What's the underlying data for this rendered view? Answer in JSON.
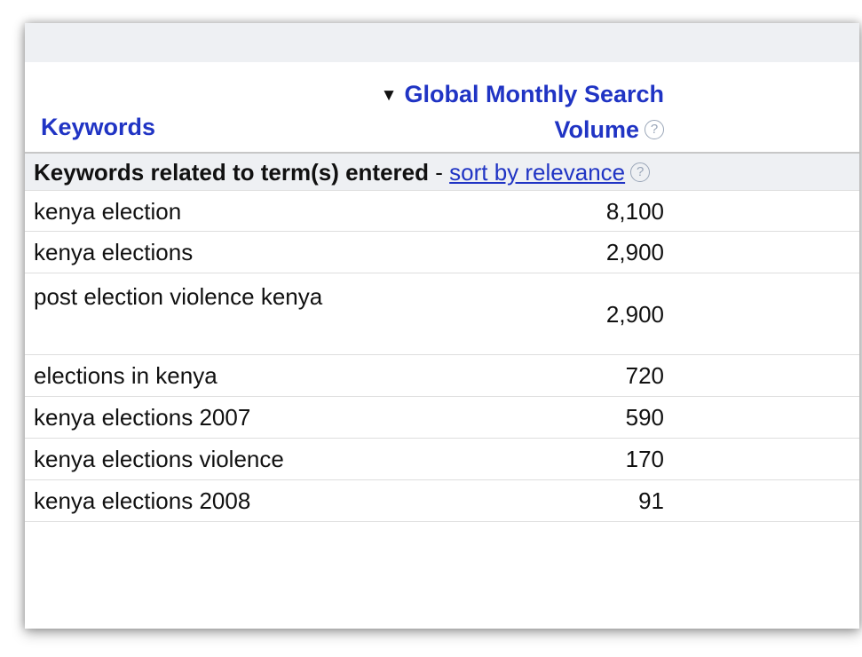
{
  "header": {
    "keywords_label": "Keywords",
    "volume_label_line1": "Global Monthly Search",
    "volume_label_line2": "Volume",
    "sort_arrow": "▼",
    "help": "?"
  },
  "group": {
    "title": "Keywords related to term(s) entered",
    "separator": " - ",
    "sort_link": "sort by relevance",
    "help": "?"
  },
  "rows": [
    {
      "keyword": "kenya election",
      "volume": "8,100"
    },
    {
      "keyword": "kenya elections",
      "volume": "2,900"
    },
    {
      "keyword": "post election violence kenya",
      "volume": "2,900"
    },
    {
      "keyword": "elections in kenya",
      "volume": "720"
    },
    {
      "keyword": "kenya elections 2007",
      "volume": "590"
    },
    {
      "keyword": "kenya elections violence",
      "volume": "170"
    },
    {
      "keyword": "kenya elections 2008",
      "volume": "91"
    }
  ]
}
